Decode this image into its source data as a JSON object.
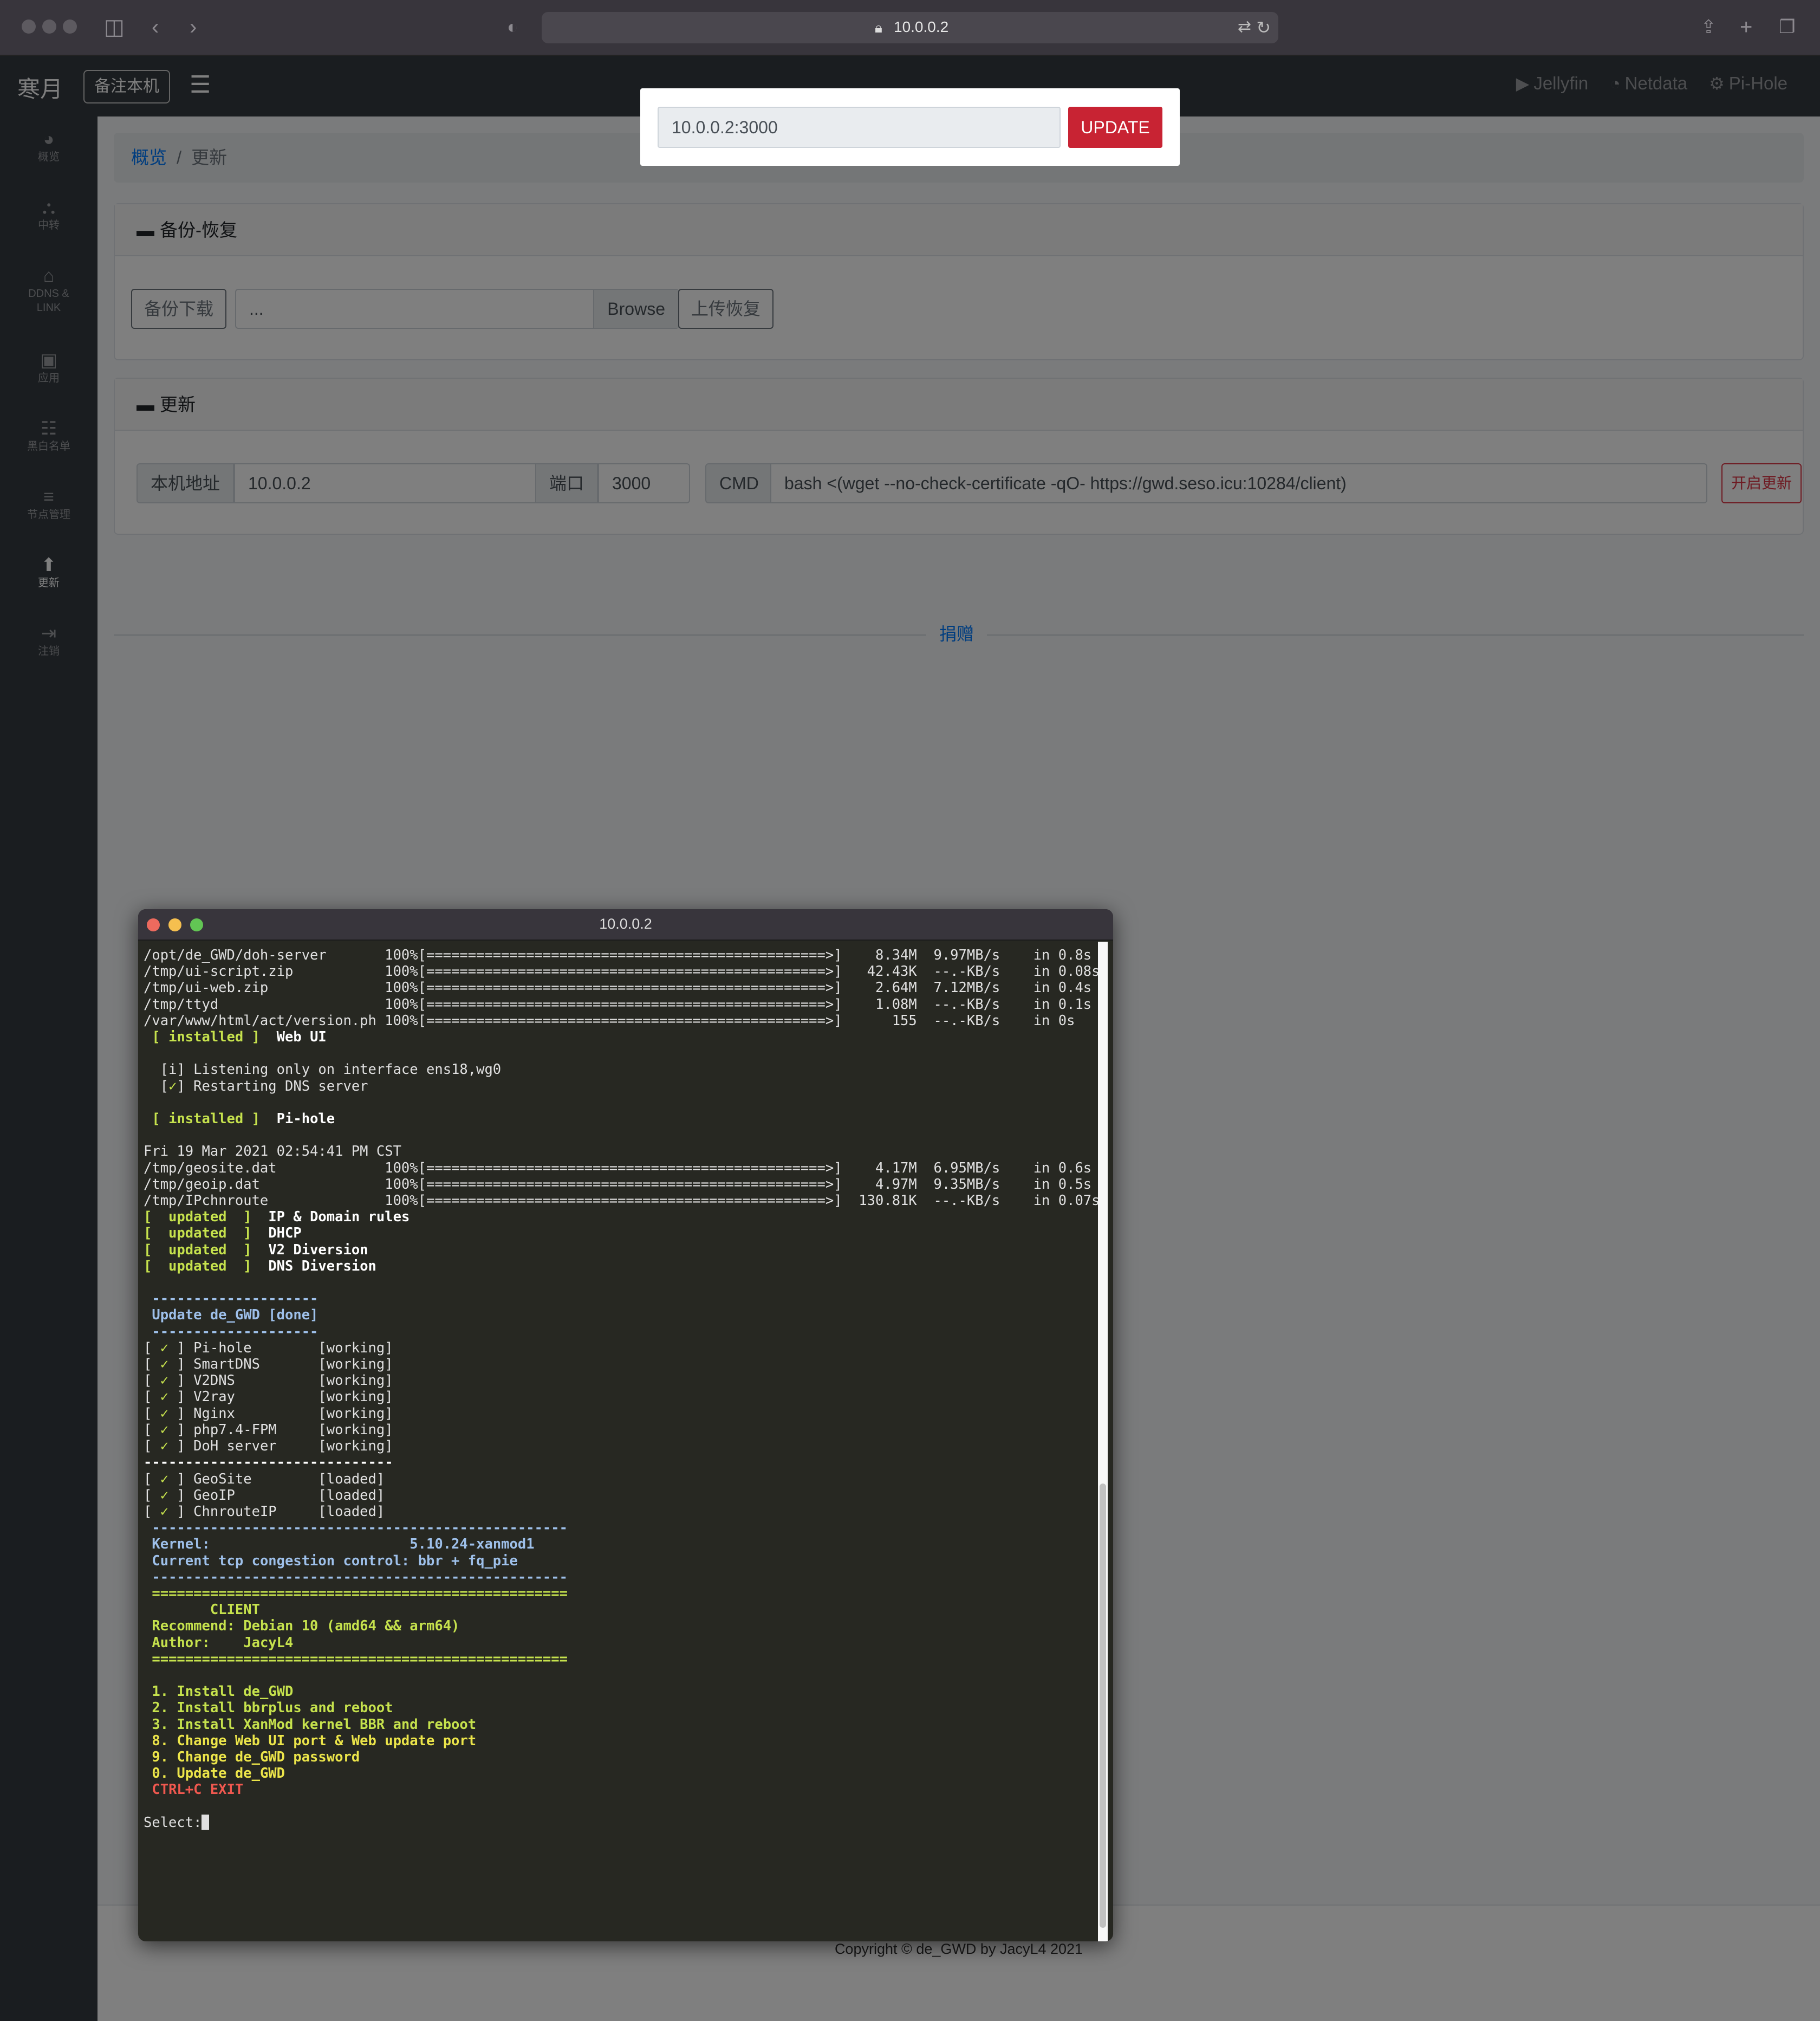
{
  "browser": {
    "url": "10.0.0.2",
    "lock_icon": "lock-icon",
    "reload_icon": "reload-icon"
  },
  "app": {
    "brand": "寒月",
    "note_button": "备注本机",
    "nav_links": [
      {
        "icon": "youtube-icon",
        "label": "Jellyfin"
      },
      {
        "icon": "gauge-icon",
        "label": "Netdata"
      },
      {
        "icon": "gear-icon",
        "label": "Pi-Hole"
      }
    ]
  },
  "sidebar": {
    "items": [
      {
        "icon": "dashboard-icon",
        "label": "概览"
      },
      {
        "icon": "relay-icon",
        "label": "中转"
      },
      {
        "icon": "ddns-icon",
        "label": "DDNS &",
        "label2": "LINK"
      },
      {
        "icon": "app-icon",
        "label": "应用"
      },
      {
        "icon": "list-icon",
        "label": "黑白名单"
      },
      {
        "icon": "nodes-icon",
        "label": "节点管理"
      },
      {
        "icon": "update-icon",
        "label": "更新"
      },
      {
        "icon": "logout-icon",
        "label": "注销"
      }
    ]
  },
  "breadcrumb": {
    "home": "概览",
    "separator": "/",
    "current": "更新"
  },
  "backup_card": {
    "title": "备份-恢复",
    "download_button": "备份下载",
    "file_value": "...",
    "browse_label": "Browse",
    "upload_button": "上传恢复"
  },
  "update_card": {
    "title": "更新",
    "address_label": "本机地址",
    "address_value": "10.0.0.2",
    "port_label": "端口",
    "port_value": "3000",
    "cmd_label": "CMD",
    "cmd_value": "bash <(wget --no-check-certificate -qO- https://gwd.seso.icu:10284/client)",
    "start_button": "开启更新"
  },
  "donate": "捐赠",
  "footer": "Copyright © de_GWD by JacyL4 2021",
  "popup": {
    "input_value": "10.0.0.2:3000",
    "button": "UPDATE"
  },
  "terminal": {
    "title": "10.0.0.2",
    "downloads1": [
      {
        "path": "/opt/de_GWD/doh-server",
        "pct": "100%",
        "size": "8.34M",
        "rate": "9.97MB/s",
        "time": "in 0.8s"
      },
      {
        "path": "/tmp/ui-script.zip",
        "pct": "100%",
        "size": "42.43K",
        "rate": "--.-KB/s",
        "time": "in 0.08s"
      },
      {
        "path": "/tmp/ui-web.zip",
        "pct": "100%",
        "size": "2.64M",
        "rate": "7.12MB/s",
        "time": "in 0.4s"
      },
      {
        "path": "/tmp/ttyd",
        "pct": "100%",
        "size": "1.08M",
        "rate": "--.-KB/s",
        "time": "in 0.1s"
      },
      {
        "path": "/var/www/html/act/version.ph",
        "pct": "100%",
        "size": "155",
        "rate": "--.-KB/s",
        "time": "in 0s"
      }
    ],
    "installed_tag": "[ installed ]",
    "webui": "Web UI",
    "info_line": "[i] Listening only on interface ens18,wg0",
    "restart_line": "Restarting DNS server",
    "pihole": "Pi-hole",
    "date_line": "Fri 19 Mar 2021 02:54:41 PM CST",
    "downloads2": [
      {
        "path": "/tmp/geosite.dat",
        "pct": "100%",
        "size": "4.17M",
        "rate": "6.95MB/s",
        "time": "in 0.6s"
      },
      {
        "path": "/tmp/geoip.dat",
        "pct": "100%",
        "size": "4.97M",
        "rate": "9.35MB/s",
        "time": "in 0.5s"
      },
      {
        "path": "/tmp/IPchnroute",
        "pct": "100%",
        "size": "130.81K",
        "rate": "--.-KB/s",
        "time": "in 0.07s"
      }
    ],
    "updated_tag": "[  updated  ]",
    "updated_items": [
      "IP & Domain rules",
      "DHCP",
      "V2 Diversion",
      "DNS Diversion"
    ],
    "update_done": "Update de_GWD [done]",
    "services": [
      {
        "name": "Pi-hole",
        "status": "[working]"
      },
      {
        "name": "SmartDNS",
        "status": "[working]"
      },
      {
        "name": "V2DNS",
        "status": "[working]"
      },
      {
        "name": "V2ray",
        "status": "[working]"
      },
      {
        "name": "Nginx",
        "status": "[working]"
      },
      {
        "name": "php7.4-FPM",
        "status": "[working]"
      },
      {
        "name": "DoH server",
        "status": "[working]"
      }
    ],
    "datasets": [
      {
        "name": "GeoSite",
        "status": "[loaded]"
      },
      {
        "name": "GeoIP",
        "status": "[loaded]"
      },
      {
        "name": "ChnrouteIP",
        "status": "[loaded]"
      }
    ],
    "kernel_label": "Kernel:",
    "kernel_value": "5.10.24-xanmod1",
    "tcp_line": "Current tcp congestion control: bbr + fq_pie",
    "client": "CLIENT",
    "recommend": "Recommend: Debian 10 (amd64 && arm64)",
    "author": "Author:    JacyL4",
    "menu": [
      "1. Install de_GWD",
      "2. Install bbrplus and reboot",
      "3. Install XanMod kernel BBR and reboot",
      "8. Change Web UI port & Web update port",
      "9. Change de_GWD password",
      "0. Update de_GWD"
    ],
    "exit": "CTRL+C EXIT",
    "prompt": "Select:"
  }
}
